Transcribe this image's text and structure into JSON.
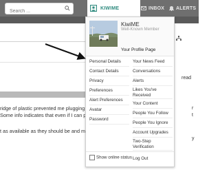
{
  "search": {
    "placeholder": "Search ..."
  },
  "nav": {
    "user_label": "KIWIME",
    "inbox_label": "INBOX",
    "alerts_label": "ALERTS"
  },
  "page": {
    "fragment_right_1": "read",
    "snippet_line1": "ridge of plastic prevented me plugging",
    "snippet_line2": "Some info indicates that even if I can p",
    "snippet_line3": "t as available as they should be and m",
    "right_r": "r",
    "right_t": "t",
    "right_y": "y"
  },
  "dropdown": {
    "name": "KiwiME",
    "role": "Well-Known Member",
    "profile_link": "Your Profile Page",
    "left_items": [
      "Personal Details",
      "Contact Details",
      "Privacy",
      "Preferences",
      "Alert Preferences",
      "Avatar",
      "Password"
    ],
    "right_items": [
      "Your News Feed",
      "Conversations",
      "Alerts",
      "Likes You've Received",
      "Your Content",
      "People You Follow",
      "People You Ignore",
      "Account Upgrades",
      "Two-Step Verification"
    ],
    "show_online_status": "Show online status",
    "logout": "Log Out"
  },
  "colors": {
    "topbar": "#6f6f6f",
    "accent": "#2f8b7f"
  }
}
